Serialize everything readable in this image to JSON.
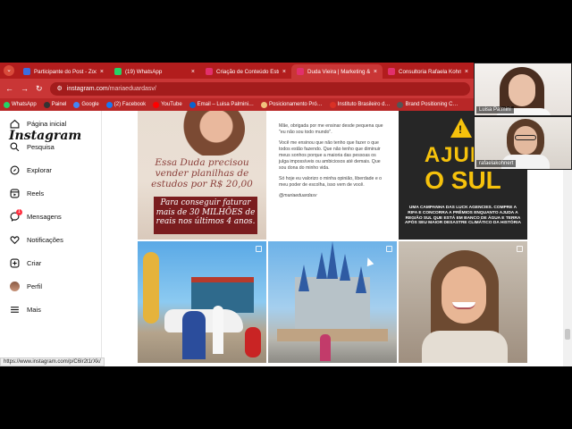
{
  "browser": {
    "tabs": [
      {
        "label": "Participante do Post - Zoom",
        "color": "#3b6ee0",
        "active": false
      },
      {
        "label": "(19) WhatsApp",
        "color": "#25d366",
        "active": false
      },
      {
        "label": "Criação de Conteúdo Estratégico",
        "color": "#e1306c",
        "active": false
      },
      {
        "label": "Duda Vieira | Marketing & Cont",
        "color": "#e1306c",
        "active": true
      },
      {
        "label": "Consultoria Rafaela Kohnert",
        "color": "#e1306c",
        "active": false
      }
    ],
    "url_host": "instagram.com",
    "url_path": "/mariaeduardasv/",
    "bookmarks": [
      {
        "label": "WhatsApp",
        "color": "#25d366"
      },
      {
        "label": "Painel",
        "color": "#333333"
      },
      {
        "label": "Google",
        "color": "#4285f4"
      },
      {
        "label": "(2) Facebook",
        "color": "#1877f2"
      },
      {
        "label": "YouTube",
        "color": "#ff0000"
      },
      {
        "label": "Email – Luisa Palmini…",
        "color": "#0b63ce"
      },
      {
        "label": "Posicionamento Pró…",
        "color": "#f1c27d"
      },
      {
        "label": "Instituto Brasileiro d…",
        "color": "#d93025"
      },
      {
        "label": "Brand Positioning C…",
        "color": "#555555"
      }
    ],
    "status_url": "https://www.instagram.com/p/C6Ir2t1rXk/"
  },
  "instagram": {
    "logo": "Instagram",
    "nav": [
      {
        "label": "Página inicial",
        "icon": "home-icon"
      },
      {
        "label": "Pesquisa",
        "icon": "search-icon"
      },
      {
        "label": "Explorar",
        "icon": "compass-icon"
      },
      {
        "label": "Reels",
        "icon": "reels-icon"
      },
      {
        "label": "Mensagens",
        "icon": "messenger-icon",
        "badge": "1"
      },
      {
        "label": "Notificações",
        "icon": "heart-icon"
      },
      {
        "label": "Criar",
        "icon": "plus-square-icon"
      },
      {
        "label": "Perfil",
        "icon": "avatar"
      },
      {
        "label": "Mais",
        "icon": "menu-icon"
      }
    ],
    "posts": {
      "p1_line1": "Essa Duda precisou vender planilhas de estudos por R$ 20,00",
      "p1_line2": "Para conseguir faturar mais de 30 MILHÕES de reais nos últimos 4 anos.",
      "p2_para1": "Mãe, obrigada por me ensinar desde pequena que \"eu não sou todo mundo\".",
      "p2_para2": "Você me ensinou que não tenho que fazer o que todos estão fazendo. Que não tenho que diminuir meus sonhos porque a maioria das pessoas os julga impossíveis ou ambiciosos até demais. Que sou dona do minho vida.",
      "p2_para3": "Só hoje eu valorizo o minha opinião, liberdade e o meu poder de escolha, isso vem de você.",
      "p2_handle": "@mariaeduardasv",
      "p3_big1": "AJUDE",
      "p3_big2": "O SUL",
      "p3_small": "UMA CAMPANHA DAS LUCK AGENCIES. COMPRE A RIFA E CONCORRA A PRÊMIOS ENQUANTO AJUDA A REGIÃO SUL QUE ESTÁ EM BANCO DE ÁGUA E TERRA APÓS SEU MAIOR DESASTRE CLIMÁTICO DA HISTÓRIA"
    }
  },
  "zoom": {
    "participants": [
      {
        "name": "Luisa Palmini"
      },
      {
        "name": "rafaelakohnert"
      }
    ]
  }
}
